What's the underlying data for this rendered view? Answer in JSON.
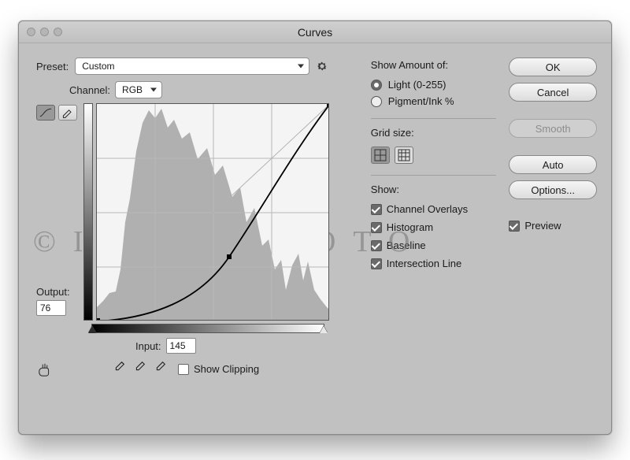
{
  "window": {
    "title": "Curves"
  },
  "preset": {
    "label": "Preset:",
    "value": "Custom"
  },
  "channel": {
    "label": "Channel:",
    "value": "RGB"
  },
  "output": {
    "label": "Output:",
    "value": "76"
  },
  "input": {
    "label": "Input:",
    "value": "145"
  },
  "show_clipping": {
    "label": "Show Clipping",
    "checked": false
  },
  "amount": {
    "title": "Show Amount of:",
    "light": "Light  (0-255)",
    "pigment": "Pigment/Ink %",
    "selected": "light"
  },
  "grid": {
    "title": "Grid size:"
  },
  "show": {
    "title": "Show:",
    "items": [
      {
        "label": "Channel Overlays",
        "checked": true
      },
      {
        "label": "Histogram",
        "checked": true
      },
      {
        "label": "Baseline",
        "checked": true
      },
      {
        "label": "Intersection Line",
        "checked": true
      }
    ]
  },
  "buttons": {
    "ok": "OK",
    "cancel": "Cancel",
    "smooth": "Smooth",
    "auto": "Auto",
    "options": "Options..."
  },
  "preview": {
    "label": "Preview",
    "checked": true
  },
  "chart_data": {
    "type": "line",
    "title": "Curves",
    "xlabel": "Input",
    "ylabel": "Output",
    "xlim": [
      0,
      255
    ],
    "ylim": [
      0,
      255
    ],
    "series": [
      {
        "name": "Baseline",
        "x": [
          0,
          255
        ],
        "y": [
          0,
          255
        ]
      },
      {
        "name": "Curve",
        "x": [
          0,
          64,
          128,
          145,
          192,
          255
        ],
        "y": [
          0,
          12,
          46,
          76,
          150,
          255
        ]
      }
    ],
    "points": [
      {
        "x": 0,
        "y": 0
      },
      {
        "x": 145,
        "y": 76
      },
      {
        "x": 255,
        "y": 255
      }
    ]
  },
  "watermark": "©IJOYERFOTO"
}
